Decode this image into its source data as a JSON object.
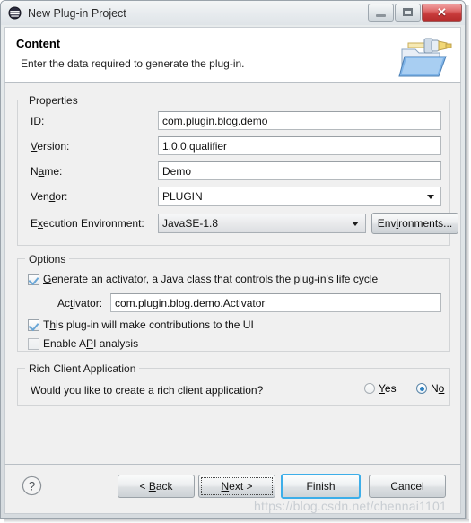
{
  "window": {
    "title": "New Plug-in Project",
    "app_icon": "eclipse-circle-icon",
    "controls": {
      "minimize": "minimize-icon",
      "maximize": "maximize-icon",
      "close": "✕"
    }
  },
  "header": {
    "title": "Content",
    "description": "Enter the data required to generate the plug-in.",
    "banner_icon": "plugin-folder-icon"
  },
  "properties": {
    "legend": "Properties",
    "fields": [
      {
        "label_pre": "",
        "label_mn": "I",
        "label_post": "D:",
        "value": "com.plugin.blog.demo",
        "kind": "text"
      },
      {
        "label_pre": "",
        "label_mn": "V",
        "label_post": "ersion:",
        "value": "1.0.0.qualifier",
        "kind": "text"
      },
      {
        "label_pre": "N",
        "label_mn": "a",
        "label_post": "me:",
        "value": "Demo",
        "kind": "text"
      },
      {
        "label_pre": "Ven",
        "label_mn": "d",
        "label_post": "or:",
        "value": "PLUGIN",
        "kind": "combo"
      },
      {
        "label_pre": "E",
        "label_mn": "x",
        "label_post": "ecution Environment:",
        "value": "JavaSE-1.8",
        "kind": "combo-readonly"
      }
    ],
    "environments_button": {
      "pre": "Env",
      "mn": "i",
      "post": "ronments..."
    }
  },
  "options": {
    "legend": "Options",
    "generate_activator": {
      "pre": "",
      "mn": "G",
      "post": "enerate an activator, a Java class that controls the plug-in's life cycle",
      "checked": true
    },
    "activator": {
      "label_pre": "Ac",
      "label_mn": "t",
      "label_post": "ivator:",
      "value": "com.plugin.blog.demo.Activator"
    },
    "ui_contributions": {
      "pre": "T",
      "mn": "h",
      "post": "is plug-in will make contributions to the UI",
      "checked": true
    },
    "api_analysis": {
      "pre": "Enable A",
      "mn": "P",
      "post": "I analysis",
      "checked": false
    }
  },
  "rich_client": {
    "legend": "Rich Client Application",
    "question": "Would you like to create a rich client application?",
    "yes": {
      "pre": "",
      "mn": "Y",
      "post": "es",
      "selected": false
    },
    "no": {
      "pre": "N",
      "mn": "o",
      "post": "",
      "selected": true
    }
  },
  "footer": {
    "help_icon": "help-question-icon",
    "buttons": [
      {
        "pre": "< ",
        "mn": "B",
        "post": "ack",
        "state": "normal"
      },
      {
        "pre": "",
        "mn": "N",
        "post": "ext >",
        "state": "focused"
      },
      {
        "pre": "Finish",
        "mn": "",
        "post": "",
        "state": "default"
      },
      {
        "pre": "Cancel",
        "mn": "",
        "post": "",
        "state": "normal"
      }
    ]
  },
  "watermark": "https://blog.csdn.net/chennai1101"
}
